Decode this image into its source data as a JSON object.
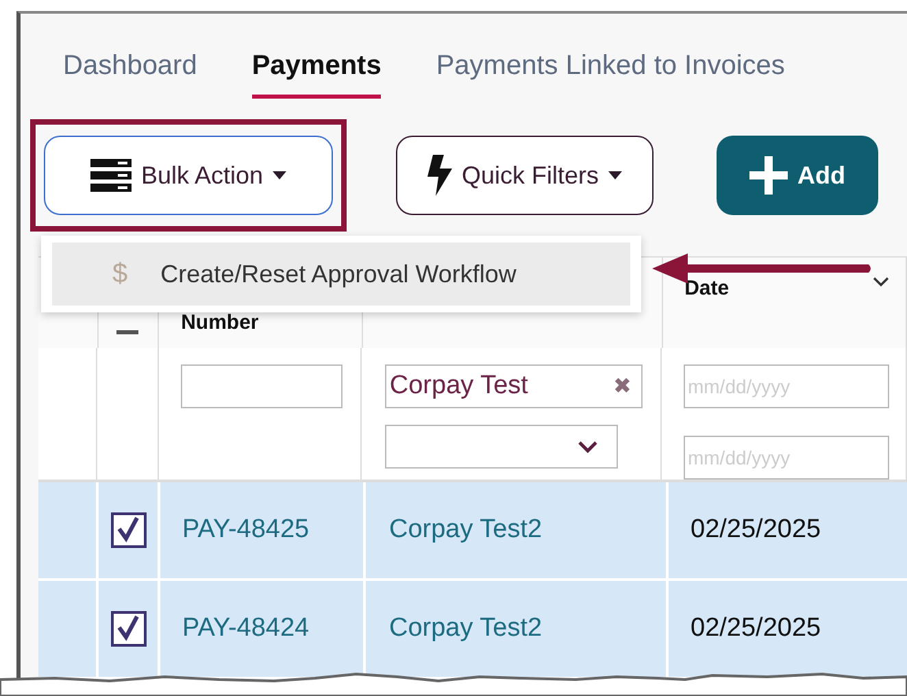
{
  "tabs": [
    {
      "label": "Dashboard",
      "selected": false
    },
    {
      "label": "Payments",
      "selected": true
    },
    {
      "label": "Payments Linked to Invoices",
      "selected": false
    }
  ],
  "toolbar": [
    {
      "kind": "bulk",
      "label": "Bulk Action",
      "highlighted": true
    },
    {
      "kind": "filters",
      "label": "Quick Filters",
      "highlighted": false
    },
    {
      "kind": "add",
      "label": "Add",
      "highlighted": false
    }
  ],
  "dropdown_menu": {
    "items": [
      {
        "icon": "$",
        "label": "Create/Reset Approval Workflow",
        "selected": true
      }
    ],
    "pointer_arrow": true
  },
  "table": {
    "columns": [
      {
        "label": "Number"
      },
      {
        "label": "Date"
      }
    ],
    "filters": {
      "name_value": "Corpay Test",
      "clear": "✖",
      "date_placeholders": [
        "mm/dd/yyyy",
        "mm/dd/yyyy"
      ]
    },
    "rows": [
      {
        "selected": true,
        "checked": true,
        "number": "PAY-48425",
        "name": "Corpay Test2",
        "date": "02/25/2025"
      },
      {
        "selected": true,
        "checked": true,
        "number": "PAY-48424",
        "name": "Corpay Test2",
        "date": "02/25/2025"
      }
    ]
  }
}
